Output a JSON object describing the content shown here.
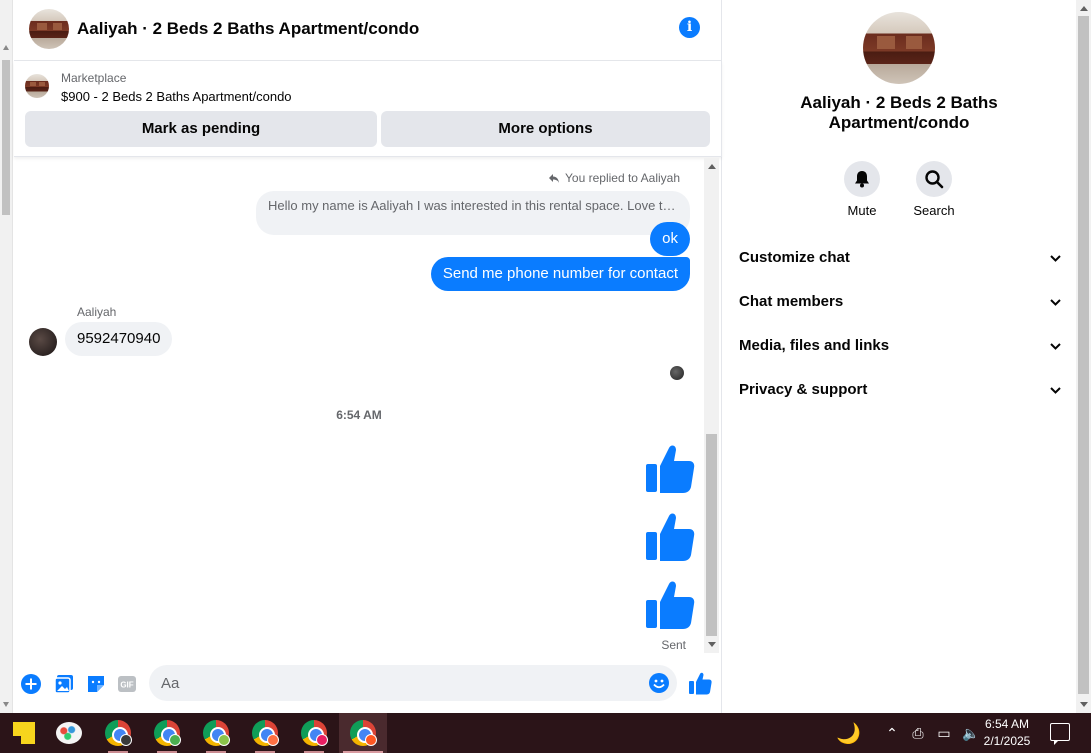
{
  "chat": {
    "header_title": "Aaliyah · 2 Beds 2 Baths Apartment/condo",
    "marketplace_label": "Marketplace",
    "listing": "$900 - 2 Beds 2 Baths Apartment/condo",
    "btn_pending": "Mark as pending",
    "btn_more": "More options"
  },
  "messages": {
    "replied_label": "You replied to Aaliyah",
    "quoted": "Hello my name is Aaliyah I was interested in this rental space. Love to ...",
    "out_ok": "ok",
    "out_phone": "Send me phone number for contact",
    "sender": "Aaliyah",
    "in_phone": "9592470940",
    "time": "6:54 AM",
    "status": "Sent"
  },
  "composer": {
    "placeholder": "Aa"
  },
  "sidebar": {
    "profile_name": "Aaliyah · 2 Beds 2 Baths Apartment/condo",
    "mute_label": "Mute",
    "search_label": "Search",
    "rows": [
      "Customize chat",
      "Chat members",
      "Media, files and links",
      "Privacy & support"
    ]
  },
  "taskbar": {
    "time": "6:54 AM",
    "date": "2/1/2025"
  },
  "colors": {
    "accent": "#0a7cff",
    "taskbar": "#2b1418"
  }
}
